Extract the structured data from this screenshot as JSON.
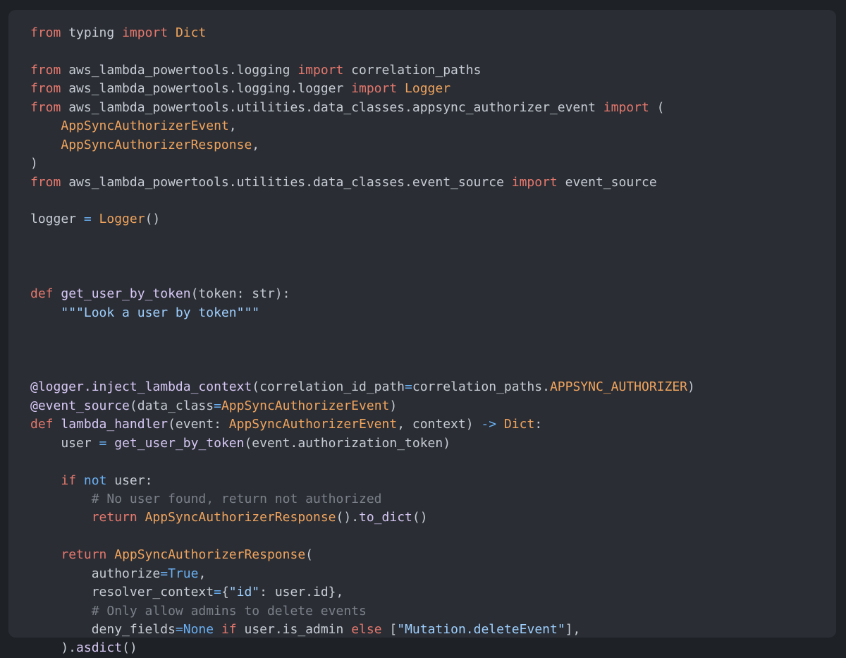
{
  "lines": [
    [
      {
        "c": "kw",
        "t": "from"
      },
      {
        "c": "pl",
        "t": " typing "
      },
      {
        "c": "kw",
        "t": "import"
      },
      {
        "c": "pl",
        "t": " "
      },
      {
        "c": "cls",
        "t": "Dict"
      }
    ],
    [],
    [
      {
        "c": "kw",
        "t": "from"
      },
      {
        "c": "pl",
        "t": " aws_lambda_powertools.logging "
      },
      {
        "c": "kw",
        "t": "import"
      },
      {
        "c": "pl",
        "t": " correlation_paths"
      }
    ],
    [
      {
        "c": "kw",
        "t": "from"
      },
      {
        "c": "pl",
        "t": " aws_lambda_powertools.logging.logger "
      },
      {
        "c": "kw",
        "t": "import"
      },
      {
        "c": "pl",
        "t": " "
      },
      {
        "c": "cls",
        "t": "Logger"
      }
    ],
    [
      {
        "c": "kw",
        "t": "from"
      },
      {
        "c": "pl",
        "t": " aws_lambda_powertools.utilities.data_classes.appsync_authorizer_event "
      },
      {
        "c": "kw",
        "t": "import"
      },
      {
        "c": "pl",
        "t": " ("
      }
    ],
    [
      {
        "c": "pl",
        "t": "    "
      },
      {
        "c": "cls",
        "t": "AppSyncAuthorizerEvent"
      },
      {
        "c": "pl",
        "t": ","
      }
    ],
    [
      {
        "c": "pl",
        "t": "    "
      },
      {
        "c": "cls",
        "t": "AppSyncAuthorizerResponse"
      },
      {
        "c": "pl",
        "t": ","
      }
    ],
    [
      {
        "c": "pl",
        "t": ")"
      }
    ],
    [
      {
        "c": "kw",
        "t": "from"
      },
      {
        "c": "pl",
        "t": " aws_lambda_powertools.utilities.data_classes.event_source "
      },
      {
        "c": "kw",
        "t": "import"
      },
      {
        "c": "pl",
        "t": " event_source"
      }
    ],
    [],
    [
      {
        "c": "pl",
        "t": "logger "
      },
      {
        "c": "kb",
        "t": "="
      },
      {
        "c": "pl",
        "t": " "
      },
      {
        "c": "cls",
        "t": "Logger"
      },
      {
        "c": "pl",
        "t": "()"
      }
    ],
    [],
    [],
    [],
    [
      {
        "c": "kw",
        "t": "def"
      },
      {
        "c": "pl",
        "t": " "
      },
      {
        "c": "fn",
        "t": "get_user_by_token"
      },
      {
        "c": "pl",
        "t": "(token: str):"
      }
    ],
    [
      {
        "c": "pl",
        "t": "    "
      },
      {
        "c": "str",
        "t": "\"\"\"Look a user by token\"\"\""
      }
    ],
    [],
    [],
    [],
    [
      {
        "c": "fn",
        "t": "@logger.inject_lambda_context"
      },
      {
        "c": "pl",
        "t": "(correlation_id_path"
      },
      {
        "c": "kb",
        "t": "="
      },
      {
        "c": "pl",
        "t": "correlation_paths."
      },
      {
        "c": "cls",
        "t": "APPSYNC_AUTHORIZER"
      },
      {
        "c": "pl",
        "t": ")"
      }
    ],
    [
      {
        "c": "fn",
        "t": "@event_source"
      },
      {
        "c": "pl",
        "t": "(data_class"
      },
      {
        "c": "kb",
        "t": "="
      },
      {
        "c": "cls",
        "t": "AppSyncAuthorizerEvent"
      },
      {
        "c": "pl",
        "t": ")"
      }
    ],
    [
      {
        "c": "kw",
        "t": "def"
      },
      {
        "c": "pl",
        "t": " "
      },
      {
        "c": "fn",
        "t": "lambda_handler"
      },
      {
        "c": "pl",
        "t": "(event: "
      },
      {
        "c": "cls",
        "t": "AppSyncAuthorizerEvent"
      },
      {
        "c": "pl",
        "t": ", context) "
      },
      {
        "c": "kb",
        "t": "->"
      },
      {
        "c": "pl",
        "t": " "
      },
      {
        "c": "cls",
        "t": "Dict"
      },
      {
        "c": "pl",
        "t": ":"
      }
    ],
    [
      {
        "c": "pl",
        "t": "    user "
      },
      {
        "c": "kb",
        "t": "="
      },
      {
        "c": "pl",
        "t": " "
      },
      {
        "c": "fn",
        "t": "get_user_by_token"
      },
      {
        "c": "pl",
        "t": "(event.authorization_token)"
      }
    ],
    [],
    [
      {
        "c": "pl",
        "t": "    "
      },
      {
        "c": "kw",
        "t": "if"
      },
      {
        "c": "pl",
        "t": " "
      },
      {
        "c": "kb",
        "t": "not"
      },
      {
        "c": "pl",
        "t": " user:"
      }
    ],
    [
      {
        "c": "pl",
        "t": "        "
      },
      {
        "c": "cm",
        "t": "# No user found, return not authorized"
      }
    ],
    [
      {
        "c": "pl",
        "t": "        "
      },
      {
        "c": "kw",
        "t": "return"
      },
      {
        "c": "pl",
        "t": " "
      },
      {
        "c": "cls",
        "t": "AppSyncAuthorizerResponse"
      },
      {
        "c": "pl",
        "t": "()."
      },
      {
        "c": "fn",
        "t": "to_dict"
      },
      {
        "c": "pl",
        "t": "()"
      }
    ],
    [],
    [
      {
        "c": "pl",
        "t": "    "
      },
      {
        "c": "kw",
        "t": "return"
      },
      {
        "c": "pl",
        "t": " "
      },
      {
        "c": "cls",
        "t": "AppSyncAuthorizerResponse"
      },
      {
        "c": "pl",
        "t": "("
      }
    ],
    [
      {
        "c": "pl",
        "t": "        authorize"
      },
      {
        "c": "kb",
        "t": "="
      },
      {
        "c": "kb",
        "t": "True"
      },
      {
        "c": "pl",
        "t": ","
      }
    ],
    [
      {
        "c": "pl",
        "t": "        resolver_context"
      },
      {
        "c": "kb",
        "t": "="
      },
      {
        "c": "pl",
        "t": "{"
      },
      {
        "c": "str",
        "t": "\"id\""
      },
      {
        "c": "pl",
        "t": ": user.id},"
      }
    ],
    [
      {
        "c": "pl",
        "t": "        "
      },
      {
        "c": "cm",
        "t": "# Only allow admins to delete events"
      }
    ],
    [
      {
        "c": "pl",
        "t": "        deny_fields"
      },
      {
        "c": "kb",
        "t": "="
      },
      {
        "c": "kb",
        "t": "None"
      },
      {
        "c": "pl",
        "t": " "
      },
      {
        "c": "kw",
        "t": "if"
      },
      {
        "c": "pl",
        "t": " user.is_admin "
      },
      {
        "c": "kw",
        "t": "else"
      },
      {
        "c": "pl",
        "t": " ["
      },
      {
        "c": "str",
        "t": "\"Mutation.deleteEvent\""
      },
      {
        "c": "pl",
        "t": "],"
      }
    ],
    [
      {
        "c": "pl",
        "t": "    )."
      },
      {
        "c": "fn",
        "t": "asdict"
      },
      {
        "c": "pl",
        "t": "()"
      }
    ]
  ]
}
